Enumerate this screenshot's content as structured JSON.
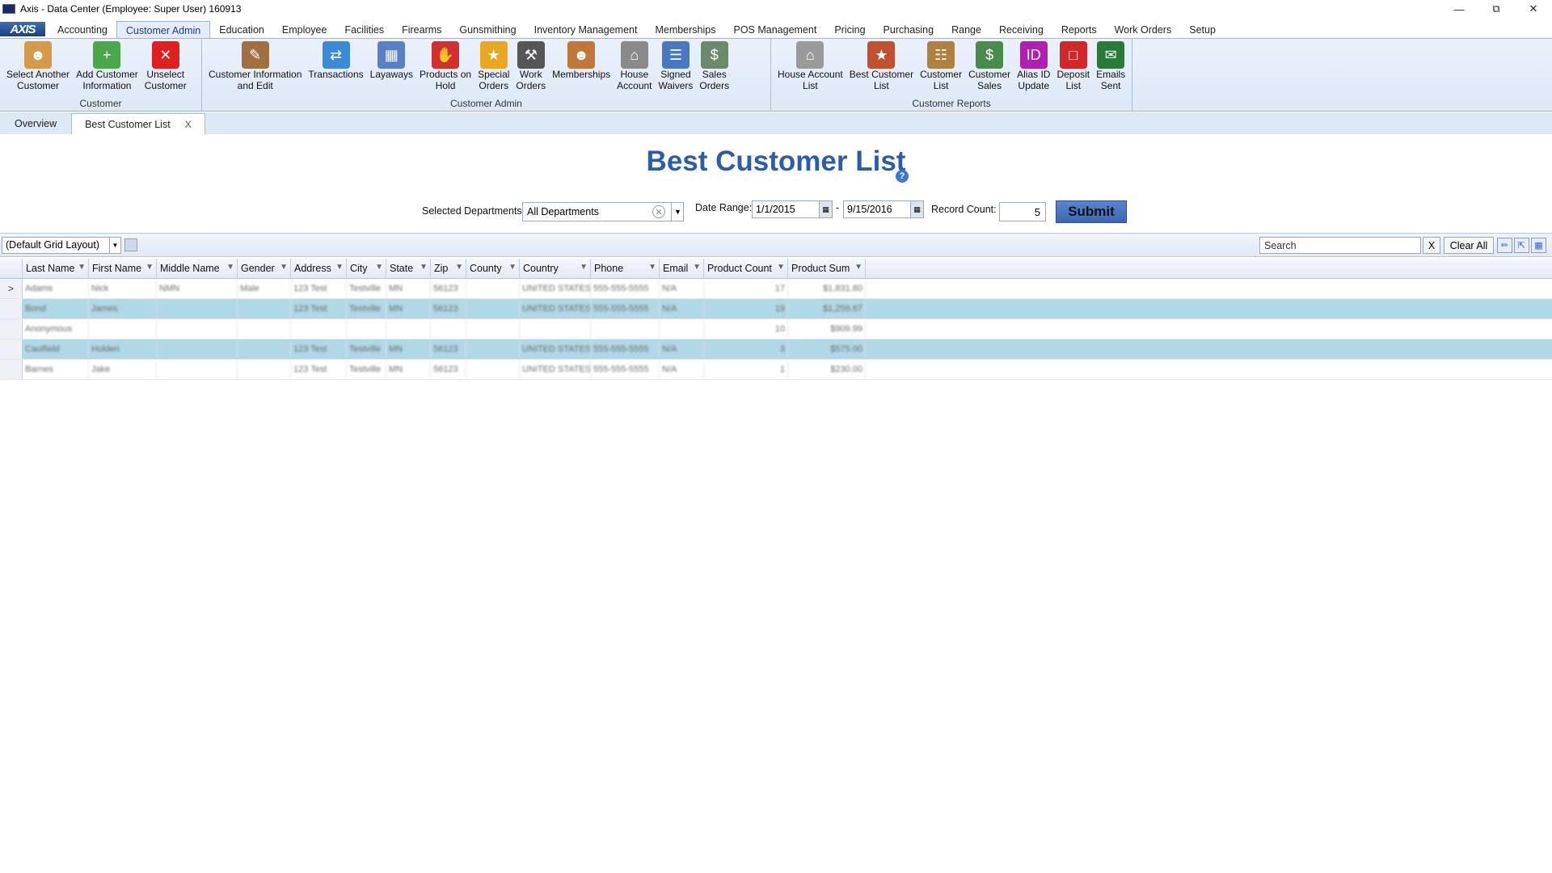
{
  "window": {
    "title": "Axis - Data Center  (Employee: Super User) 160913",
    "controls": [
      "minimize-icon",
      "restore-icon",
      "close-icon"
    ]
  },
  "logo": "AXIS",
  "tabs": [
    "Accounting",
    "Customer Admin",
    "Education",
    "Employee",
    "Facilities",
    "Firearms",
    "Gunsmithing",
    "Inventory Management",
    "Memberships",
    "POS Management",
    "Pricing",
    "Purchasing",
    "Range",
    "Receiving",
    "Reports",
    "Work Orders",
    "Setup"
  ],
  "active_tab": "Customer Admin",
  "ribbon": {
    "groups": [
      {
        "label": "Customer",
        "buttons": [
          {
            "label": "Select Another\nCustomer",
            "icon": "person-icon",
            "color": "#d49a4a"
          },
          {
            "label": "Add Customer\nInformation",
            "icon": "add-person-icon",
            "color": "#4aa84a"
          },
          {
            "label": "Unselect\nCustomer",
            "icon": "red-x-icon",
            "color": "#e02020"
          }
        ]
      },
      {
        "label": "Customer Admin",
        "buttons": [
          {
            "label": "Customer Information\nand Edit",
            "icon": "person-edit-icon",
            "color": "#a07040"
          },
          {
            "label": "Transactions",
            "icon": "arrows-icon",
            "color": "#3a8ad8"
          },
          {
            "label": "Layaways",
            "icon": "calendar-icon",
            "color": "#5a7fc8"
          },
          {
            "label": "Products on\nHold",
            "icon": "stop-hand-icon",
            "color": "#d03030"
          },
          {
            "label": "Special\nOrders",
            "icon": "special-tag-icon",
            "color": "#e8a820"
          },
          {
            "label": "Work\nOrders",
            "icon": "tools-icon",
            "color": "#555555"
          },
          {
            "label": "Memberships",
            "icon": "people-icon",
            "color": "#c07838"
          },
          {
            "label": "House\nAccount",
            "icon": "house-icon",
            "color": "#8a8a8a"
          },
          {
            "label": "Signed\nWaivers",
            "icon": "waiver-doc-icon",
            "color": "#4a78c0"
          },
          {
            "label": "Sales\nOrders",
            "icon": "sales-doc-icon",
            "color": "#6a8a6a"
          }
        ]
      },
      {
        "label": "Customer Reports",
        "buttons": [
          {
            "label": "House Account\nList",
            "icon": "house-list-icon",
            "color": "#9a9a9a"
          },
          {
            "label": "Best Customer\nList",
            "icon": "star-list-icon",
            "color": "#c05030"
          },
          {
            "label": "Customer\nList",
            "icon": "clipboard-icon",
            "color": "#b08040"
          },
          {
            "label": "Customer\nSales",
            "icon": "money-icon",
            "color": "#4a8a4a"
          },
          {
            "label": "Alias ID\nUpdate",
            "icon": "id-icon",
            "color": "#b020b0"
          },
          {
            "label": "Deposit\nList",
            "icon": "folder-icon",
            "color": "#d02828"
          },
          {
            "label": "Emails\nSent",
            "icon": "email-icon",
            "color": "#2a7a3a"
          }
        ]
      }
    ]
  },
  "doc_tabs": [
    {
      "label": "Overview"
    },
    {
      "label": "Best Customer List",
      "close": "X"
    }
  ],
  "page": {
    "title": "Best Customer List",
    "help": "?"
  },
  "filters": {
    "departments_label": "Selected Departments:",
    "departments_value": "All Departments",
    "date_range_label": "Date Range:",
    "date_from": "1/1/2015",
    "date_sep": "-",
    "date_to": "9/15/2016",
    "record_count_label": "Record Count:",
    "record_count": "5",
    "submit": "Submit"
  },
  "gridbar": {
    "layout": "(Default Grid Layout)",
    "search_placeholder": "Search",
    "search_clear": "X",
    "clear_all": "Clear All"
  },
  "grid": {
    "columns": [
      "Last Name",
      "First Name",
      "Middle Name",
      "Gender",
      "Address",
      "City",
      "State",
      "Zip",
      "County",
      "Country",
      "Phone",
      "Email",
      "Product Count",
      "Product Sum"
    ],
    "rows": [
      [
        "Adams",
        "Nick",
        "NMN",
        "Male",
        "123 Test",
        "Testville",
        "MN",
        "56123",
        "",
        "UNITED STATES",
        "555-555-5555",
        "N/A",
        "17",
        "$1,831.80"
      ],
      [
        "Bond",
        "James",
        "",
        "",
        "123 Test",
        "Testville",
        "MN",
        "56123",
        "",
        "UNITED STATES",
        "555-555-5555",
        "N/A",
        "19",
        "$1,259.67"
      ],
      [
        "Anonymous",
        "",
        "",
        "",
        "",
        "",
        "",
        "",
        "",
        "",
        "",
        "",
        "10",
        "$909.99"
      ],
      [
        "Caulfield",
        "Holden",
        "",
        "",
        "123 Test",
        "Testville",
        "MN",
        "56123",
        "",
        "UNITED STATES",
        "555-555-5555",
        "N/A",
        "3",
        "$575.00"
      ],
      [
        "Barnes",
        "Jake",
        "",
        "",
        "123 Test",
        "Testville",
        "MN",
        "56123",
        "",
        "UNITED STATES",
        "555-555-5555",
        "N/A",
        "1",
        "$230.00"
      ]
    ],
    "current_row_marker": ">"
  }
}
